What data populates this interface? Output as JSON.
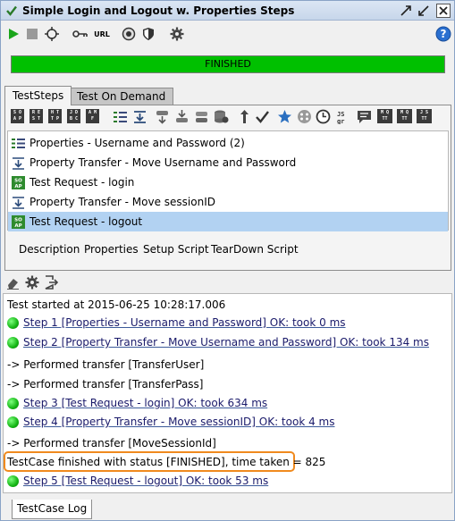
{
  "window": {
    "title": "Simple Login and Logout w. Properties Steps"
  },
  "toolbar": {
    "url_label": "URL",
    "icons": [
      "play-icon",
      "stop-icon",
      "target-icon",
      "key-icon",
      "url-icon",
      "options-icon",
      "shield-icon",
      "gear-icon",
      "help-icon"
    ]
  },
  "progress": {
    "label": "FINISHED",
    "fraction": 1.0,
    "color": "#00c000"
  },
  "tabs": [
    {
      "label": "TestSteps",
      "active": true
    },
    {
      "label": "Test On Demand",
      "active": false
    }
  ],
  "step_toolbar": {
    "ap_buttons": [
      [
        "S O",
        "A P"
      ],
      [
        "R E",
        "S T"
      ],
      [
        "H T",
        "T P"
      ],
      [
        "J D",
        "B C"
      ]
    ],
    "ap_buttons_2": [
      [
        "A M",
        "F"
      ],
      [
        "J D",
        "B C"
      ]
    ],
    "misc_labels": [
      "M Q",
      "M Q",
      "J S"
    ]
  },
  "steps": [
    {
      "label": "Properties - Username and Password (2)",
      "icon": "properties-icon",
      "selected": false
    },
    {
      "label": "Property Transfer - Move Username and Password",
      "icon": "transfer-icon",
      "selected": false
    },
    {
      "label": "Test Request - login",
      "icon": "soap-request-icon",
      "selected": false
    },
    {
      "label": "Property Transfer - Move sessionID",
      "icon": "transfer-icon",
      "selected": false
    },
    {
      "label": "Test Request - logout",
      "icon": "soap-request-icon",
      "selected": true
    }
  ],
  "sub_tabs": [
    "Description",
    "Properties",
    "Setup Script",
    "TearDown Script"
  ],
  "log": {
    "lines": [
      {
        "text": "Test started at 2015-06-25 10:28:17.006",
        "status": "none"
      },
      {
        "text": "Step 1 [Properties - Username and Password] OK: took 0 ms",
        "status": "ok"
      },
      {
        "text": "Step 2 [Property Transfer - Move Username and Password] OK: took 134 ms",
        "status": "ok"
      },
      {
        "text": "-> Performed transfer [TransferUser]",
        "status": "none"
      },
      {
        "text": "-> Performed transfer [TransferPass]",
        "status": "none"
      },
      {
        "text": "Step 3 [Test Request - login] OK: took 634 ms",
        "status": "ok"
      },
      {
        "text": "Step 4 [Property Transfer - Move sessionID] OK: took 4 ms",
        "status": "ok"
      },
      {
        "text": "-> Performed transfer [MoveSessionId]",
        "status": "none"
      },
      {
        "text": "TestCase finished with status [FINISHED], time taken = 825",
        "status": "highlight"
      },
      {
        "text": "Step 5 [Test Request - logout] OK: took 53 ms",
        "status": "ok"
      }
    ]
  },
  "bottom_tab": {
    "label": "TestCase Log"
  },
  "colors": {
    "accent_green": "#00c000",
    "highlight_border": "#f08a1e",
    "selection": "#b2d2f2"
  }
}
